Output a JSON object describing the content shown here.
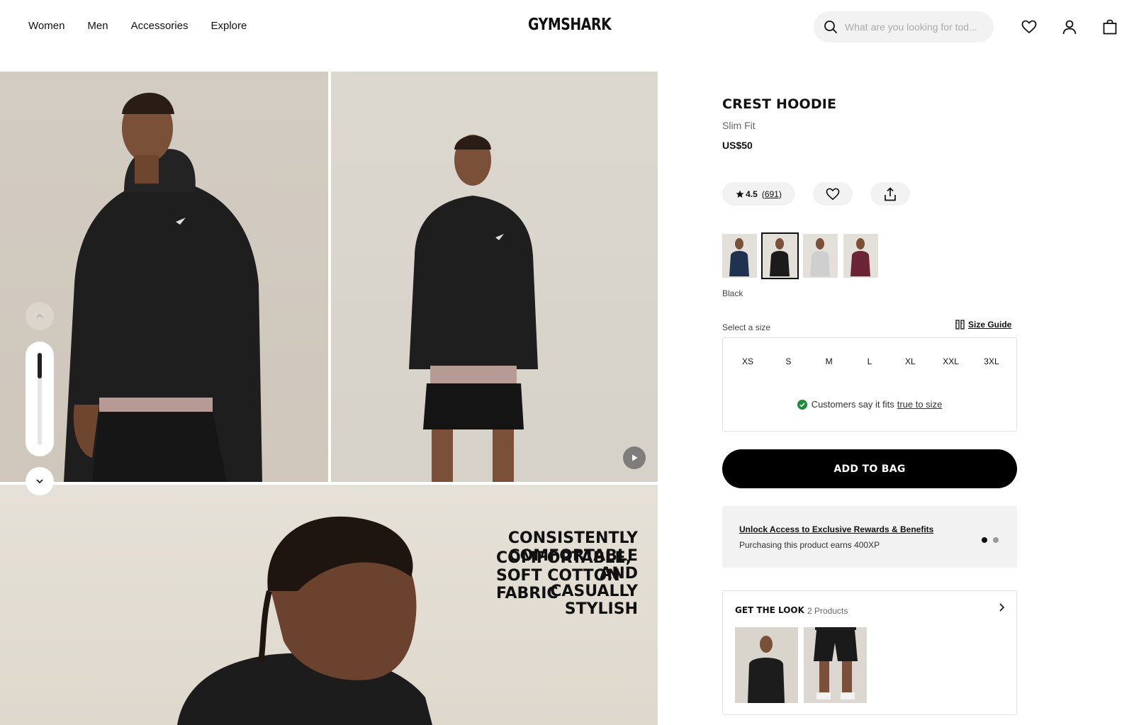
{
  "header": {
    "nav": [
      "Women",
      "Men",
      "Accessories",
      "Explore"
    ],
    "logo": "GYMSHARK",
    "search_placeholder": "What are you looking for tod..."
  },
  "gallery": {
    "headline_left": "CONSISTENTLY\nCOMFORTABLE\nAND\nCASUALLY\nSTYLISH",
    "headline_right": "COMFORTABLE,\nSOFT COTTON\nFABRIC"
  },
  "product": {
    "title": "CREST HOODIE",
    "fit": "Slim Fit",
    "price": "US$50",
    "rating": "4.5",
    "review_count": "(691)",
    "selected_color": "Black",
    "swatches": [
      {
        "color": "#1f3350",
        "name": "navy"
      },
      {
        "color": "#1b1b1b",
        "name": "black"
      },
      {
        "color": "#cfcfcf",
        "name": "light-grey"
      },
      {
        "color": "#6b2537",
        "name": "burgundy"
      }
    ]
  },
  "sizes": {
    "label": "Select a size",
    "guide": "Size Guide",
    "options": [
      "XS",
      "S",
      "M",
      "L",
      "XL",
      "XXL",
      "3XL"
    ],
    "fit_note": "Customers say it fits",
    "fit_link": "true to size"
  },
  "cta": {
    "add_to_bag": "ADD TO BAG"
  },
  "rewards": {
    "title": "Unlock Access to Exclusive Rewards & Benefits",
    "subtitle": "Purchasing this product earns 400XP"
  },
  "look": {
    "title": "GET THE LOOK",
    "count": "2 Products"
  },
  "colors": {
    "accent": "#000000",
    "success": "#1e8a3c",
    "panel_bg": "#f2f2f2"
  }
}
